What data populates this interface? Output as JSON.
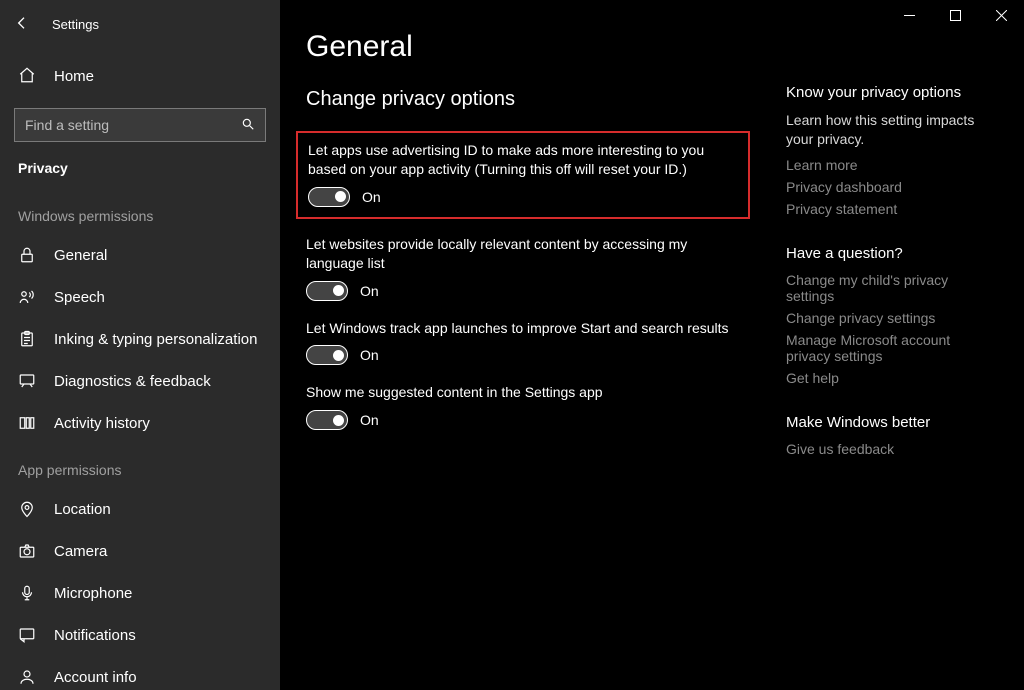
{
  "app": {
    "title": "Settings"
  },
  "sidebar": {
    "home": "Home",
    "search_placeholder": "Find a setting",
    "category": "Privacy",
    "group_win": "Windows permissions",
    "group_app": "App permissions",
    "items_win": [
      {
        "label": "General"
      },
      {
        "label": "Speech"
      },
      {
        "label": "Inking & typing personalization"
      },
      {
        "label": "Diagnostics & feedback"
      },
      {
        "label": "Activity history"
      }
    ],
    "items_app": [
      {
        "label": "Location"
      },
      {
        "label": "Camera"
      },
      {
        "label": "Microphone"
      },
      {
        "label": "Notifications"
      },
      {
        "label": "Account info"
      }
    ]
  },
  "page": {
    "h1": "General",
    "h2": "Change privacy options",
    "settings": [
      {
        "desc": "Let apps use advertising ID to make ads more interesting to you based on your app activity (Turning this off will reset your ID.)",
        "state": "On"
      },
      {
        "desc": "Let websites provide locally relevant content by accessing my language list",
        "state": "On"
      },
      {
        "desc": "Let Windows track app launches to improve Start and search results",
        "state": "On"
      },
      {
        "desc": "Show me suggested content in the Settings app",
        "state": "On"
      }
    ]
  },
  "right": {
    "privacy": {
      "title": "Know your privacy options",
      "text": "Learn how this setting impacts your privacy.",
      "links": [
        "Learn more",
        "Privacy dashboard",
        "Privacy statement"
      ]
    },
    "question": {
      "title": "Have a question?",
      "links": [
        "Change my child's privacy settings",
        "Change privacy settings",
        "Manage Microsoft account privacy settings",
        "Get help"
      ]
    },
    "better": {
      "title": "Make Windows better",
      "links": [
        "Give us feedback"
      ]
    }
  }
}
